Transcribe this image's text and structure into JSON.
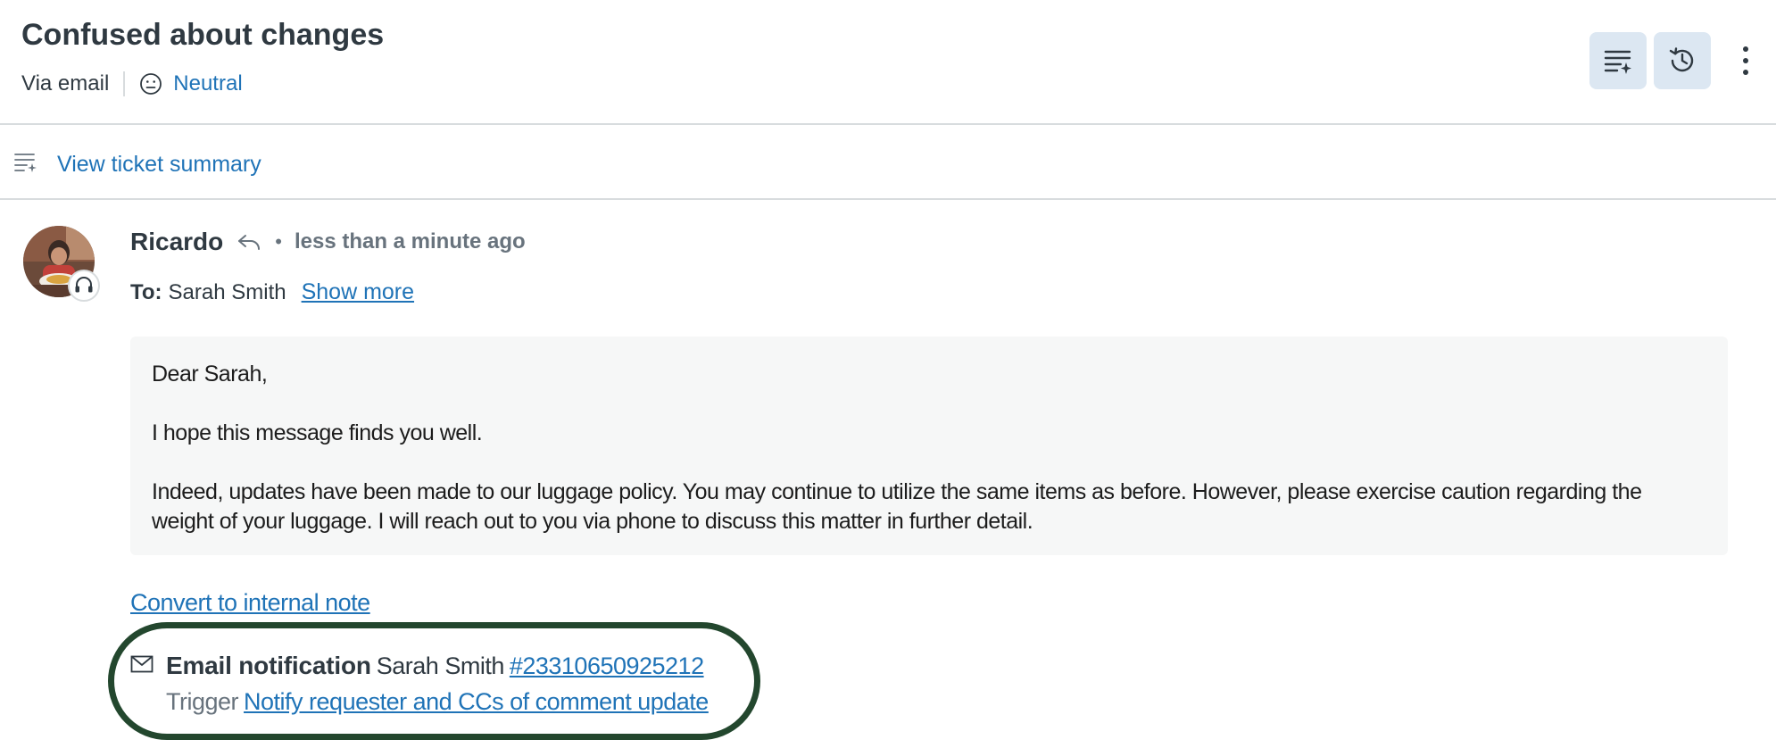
{
  "header": {
    "title": "Confused about changes",
    "channel": "Via email",
    "sentiment": "Neutral",
    "buttons": [
      "ticket-summary-icon",
      "history-icon",
      "more-vertical-icon"
    ]
  },
  "summary_bar": {
    "link": "View ticket summary",
    "icon": "summary-lines-icon"
  },
  "message": {
    "author": "Ricardo",
    "separator": "•",
    "time": "less than a minute ago",
    "to_label": "To:",
    "to_name": "Sarah Smith",
    "show_more": "Show more",
    "body": {
      "greeting": "Dear Sarah,",
      "para1": "I hope this message finds you well.",
      "para2": "Indeed, updates have been made to our luggage policy. You may continue to utilize the same items as before. However, please exercise caution regarding the weight of your luggage. I will reach out to you via phone to discuss this matter in further detail."
    },
    "convert_link": "Convert to internal note"
  },
  "notification": {
    "title": "Email notification",
    "recipient": "Sarah Smith",
    "ticket_id": "#23310650925212",
    "trigger_label": "Trigger",
    "trigger_link": "Notify requester and CCs of comment update",
    "highlight_color": "#23472e"
  },
  "colors": {
    "link": "#1f73b7",
    "text": "#2f3941",
    "muted": "#68737d",
    "button_bg": "#dce7f2"
  }
}
